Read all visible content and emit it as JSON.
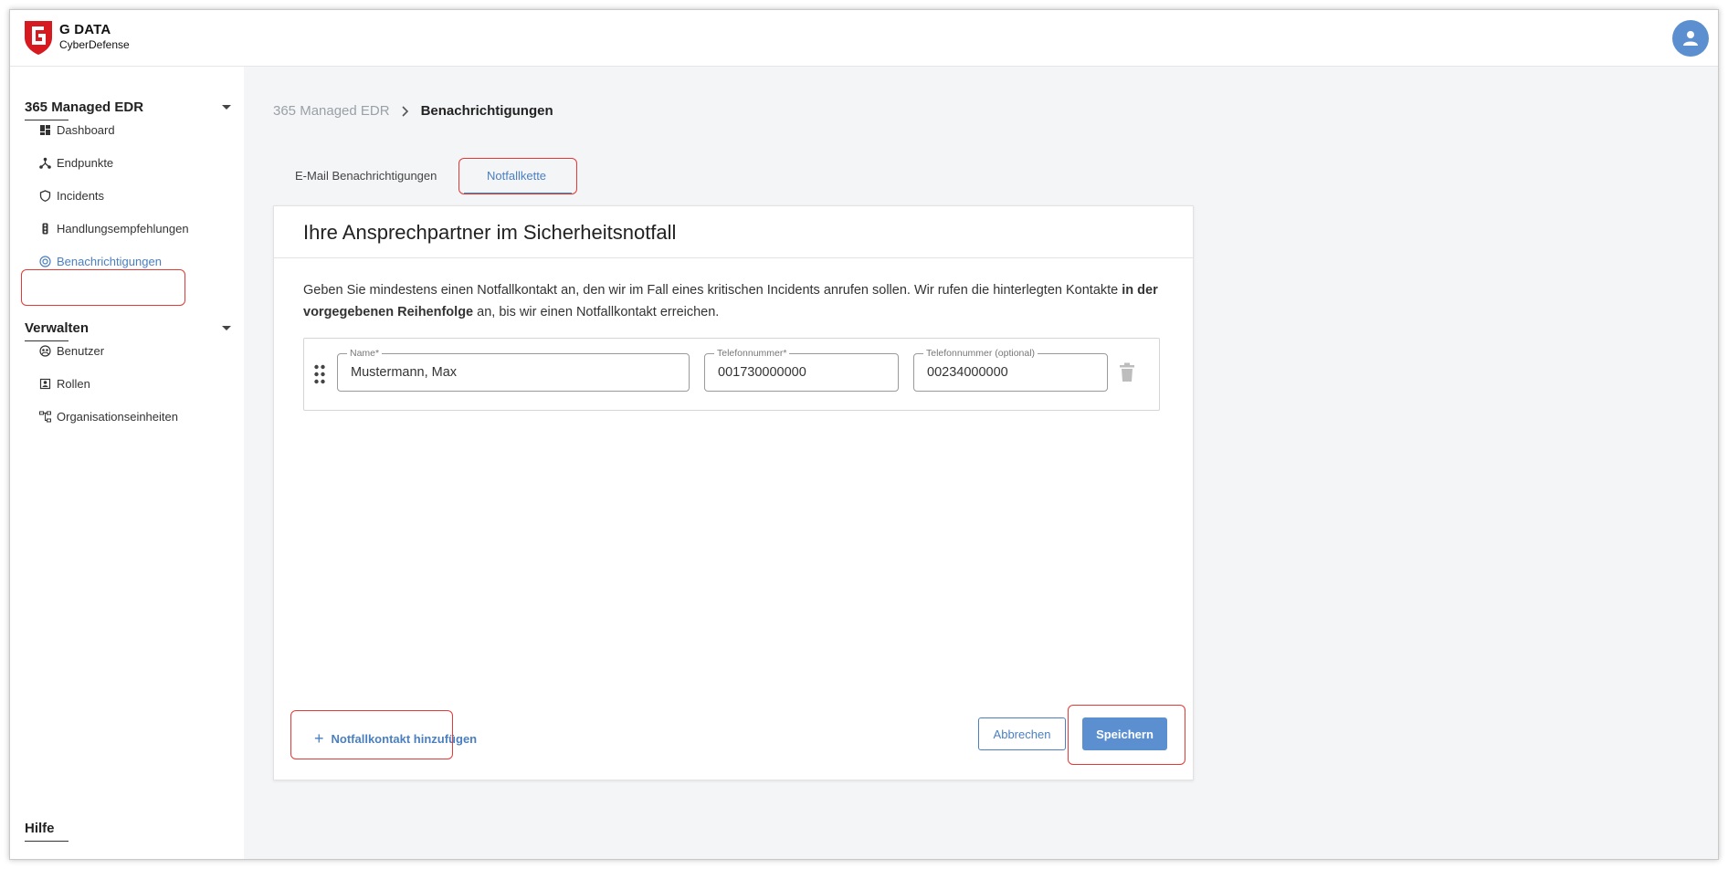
{
  "header": {
    "logo_line1": "G DATA",
    "logo_line2": "CyberDefense",
    "logo_icon": "g-data-shield-icon",
    "avatar_icon": "user-avatar-icon",
    "brand_color": "#d71920"
  },
  "sidebar": {
    "section1": {
      "title": "365 Managed EDR",
      "items": [
        {
          "label": "Dashboard",
          "icon": "dashboard-icon"
        },
        {
          "label": "Endpunkte",
          "icon": "network-nodes-icon"
        },
        {
          "label": "Incidents",
          "icon": "shield-icon"
        },
        {
          "label": "Handlungsempfehlungen",
          "icon": "traffic-light-icon"
        },
        {
          "label": "Benachrichtigungen",
          "icon": "notification-icon",
          "active": true
        }
      ]
    },
    "section2": {
      "title": "Verwalten",
      "items": [
        {
          "label": "Benutzer",
          "icon": "user-group-icon"
        },
        {
          "label": "Rollen",
          "icon": "role-badge-icon"
        },
        {
          "label": "Organisationseinheiten",
          "icon": "org-tree-icon"
        }
      ]
    },
    "help_label": "Hilfe"
  },
  "breadcrumb": {
    "items": [
      "365 Managed EDR",
      "Benachrichtigungen"
    ]
  },
  "tabs": [
    {
      "label": "E-Mail Benachrichtigungen",
      "active": false
    },
    {
      "label": "Notfallkette",
      "active": true
    }
  ],
  "card": {
    "title": "Ihre Ansprechpartner im Sicherheitsnotfall",
    "description_part1": "Geben Sie mindestens einen Notfallkontakt an, den wir im Fall eines kritischen Incidents anrufen sollen. Wir rufen die hinterlegten Kontakte",
    "description_bold": "in der vorgegebenen Reihenfolge",
    "description_part2": "an, bis wir einen Notfallkontakt erreichen.",
    "contacts": [
      {
        "name_label": "Name*",
        "name_value": "Mustermann, Max",
        "phone_label": "Telefonnummer*",
        "phone_value": "001730000000",
        "phone2_label": "Telefonnummer (optional)",
        "phone2_value": "00234000000"
      }
    ],
    "add_contact_label": "Notfallkontakt hinzufügen",
    "cancel_label": "Abbrechen",
    "save_label": "Speichern"
  },
  "colors": {
    "accent": "#4a7fc1",
    "highlight": "#e53935"
  }
}
